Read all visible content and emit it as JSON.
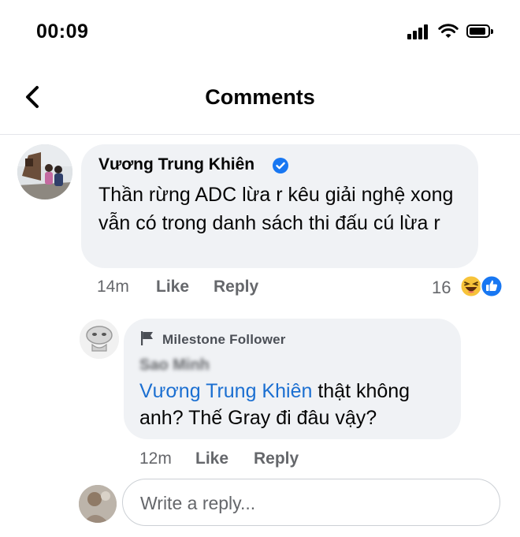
{
  "status_bar": {
    "time": "00:09"
  },
  "header": {
    "title": "Comments"
  },
  "comments": [
    {
      "author": "Vương Trung Khiên",
      "text": "Thần rừng ADC lừa r kêu giải nghệ xong vẫn có trong danh sách thi đấu cú lừa r",
      "time": "14m",
      "like_label": "Like",
      "reply_label": "Reply",
      "reaction_count": "16"
    }
  ],
  "reply": {
    "badge": "Milestone Follower",
    "author": "Sao Minh",
    "mention": "Vương Trung Khiên",
    "text": "thật không anh? Thế Gray đi đâu vậy?",
    "time": "12m",
    "like_label": "Like",
    "reply_label": "Reply"
  },
  "composer": {
    "placeholder": "Write a reply..."
  },
  "colors": {
    "link": "#1b6fd1",
    "bubble": "#f0f2f5",
    "verified": "#1877f2",
    "meta": "#65676b"
  },
  "icons": [
    "back-chevron-icon",
    "signal-icon",
    "wifi-icon",
    "battery-icon",
    "verified-badge-icon",
    "flag-icon",
    "haha-reaction-icon",
    "like-reaction-icon"
  ]
}
